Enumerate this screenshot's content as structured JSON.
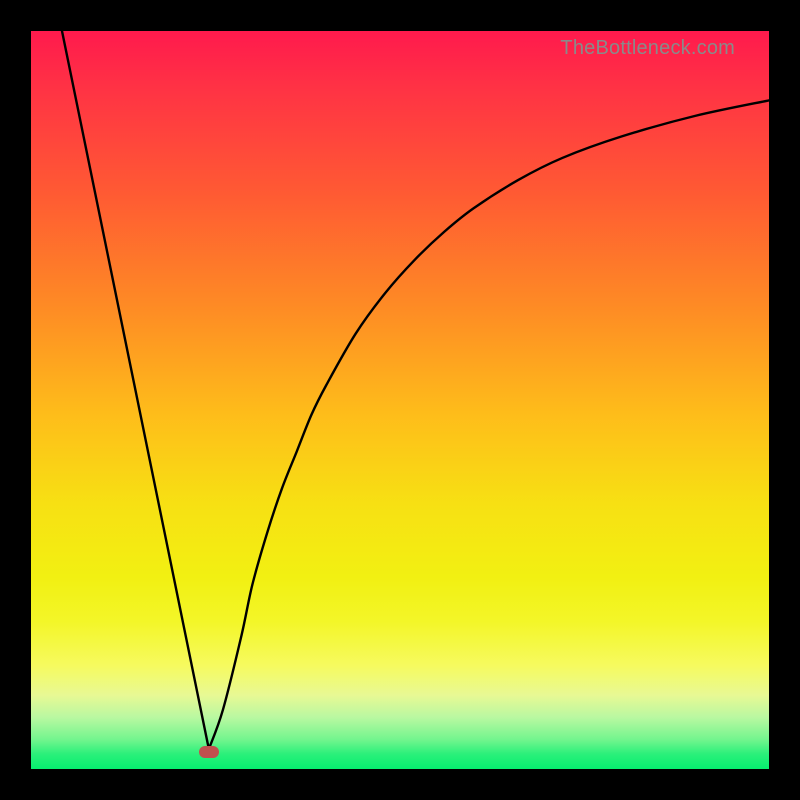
{
  "attribution": "TheBottleneck.com",
  "colors": {
    "frame": "#000000",
    "curve": "#000000",
    "marker": "#c1504e"
  },
  "chart_data": {
    "type": "line",
    "title": "",
    "xlabel": "",
    "ylabel": "",
    "xlim": [
      0,
      100
    ],
    "ylim": [
      0,
      100
    ],
    "grid": false,
    "series": [
      {
        "name": "curve-left",
        "x": [
          4.2,
          24.1
        ],
        "y": [
          100,
          2.7
        ]
      },
      {
        "name": "curve-right",
        "x": [
          24.1,
          26,
          28.5,
          30,
          32,
          34,
          36,
          38,
          40,
          44,
          48,
          52,
          56,
          60,
          66,
          72,
          80,
          90,
          100
        ],
        "y": [
          2.7,
          8,
          18,
          25,
          32,
          38,
          43,
          48,
          52,
          59,
          64.5,
          69,
          72.8,
          76,
          79.8,
          82.8,
          85.7,
          88.5,
          90.6
        ]
      }
    ],
    "marker": {
      "x": 24.1,
      "y": 2.3
    },
    "gradient_stops": [
      {
        "pos": 0.0,
        "color": "#ff1a4d"
      },
      {
        "pos": 0.08,
        "color": "#ff3344"
      },
      {
        "pos": 0.22,
        "color": "#ff5a33"
      },
      {
        "pos": 0.38,
        "color": "#fe8d24"
      },
      {
        "pos": 0.52,
        "color": "#febd1a"
      },
      {
        "pos": 0.64,
        "color": "#f7e013"
      },
      {
        "pos": 0.74,
        "color": "#f2f012"
      },
      {
        "pos": 0.8,
        "color": "#f3f628"
      },
      {
        "pos": 0.86,
        "color": "#f6fa5f"
      },
      {
        "pos": 0.9,
        "color": "#e8f994"
      },
      {
        "pos": 0.93,
        "color": "#b9f8a1"
      },
      {
        "pos": 0.96,
        "color": "#73f58e"
      },
      {
        "pos": 0.98,
        "color": "#2af07a"
      },
      {
        "pos": 1.0,
        "color": "#06ee6f"
      }
    ]
  }
}
